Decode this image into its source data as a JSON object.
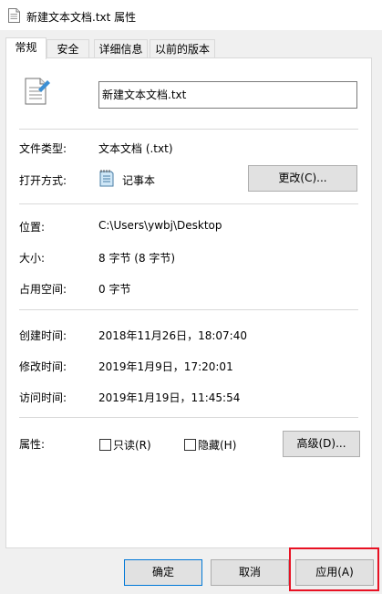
{
  "window": {
    "title": "新建文本文档.txt 属性"
  },
  "tabs": [
    {
      "label": "常规",
      "active": true
    },
    {
      "label": "安全",
      "active": false
    },
    {
      "label": "详细信息",
      "active": false
    },
    {
      "label": "以前的版本",
      "active": false
    }
  ],
  "file": {
    "name": "新建文本文档.txt"
  },
  "rows": {
    "type": {
      "label": "文件类型:",
      "value": "文本文档 (.txt)"
    },
    "opens_with": {
      "label": "打开方式:",
      "value": "记事本",
      "button": "更改(C)..."
    },
    "location": {
      "label": "位置:",
      "value": "C:\\Users\\ywbj\\Desktop"
    },
    "size": {
      "label": "大小:",
      "value": "8 字节 (8 字节)"
    },
    "size_on_disk": {
      "label": "占用空间:",
      "value": "0 字节"
    },
    "created": {
      "label": "创建时间:",
      "value": "2018年11月26日，18:07:40"
    },
    "modified": {
      "label": "修改时间:",
      "value": "2019年1月9日，17:20:01"
    },
    "accessed": {
      "label": "访问时间:",
      "value": "2019年1月19日，11:45:54"
    },
    "attributes": {
      "label": "属性:",
      "readonly": {
        "label": "只读(R)",
        "checked": false
      },
      "hidden": {
        "label": "隐藏(H)",
        "checked": false
      },
      "advanced_button": "高级(D)..."
    }
  },
  "footer": {
    "ok": "确定",
    "cancel": "取消",
    "apply": "应用(A)"
  },
  "colors": {
    "focus_border": "#0078d7",
    "highlight": "#e81123"
  }
}
